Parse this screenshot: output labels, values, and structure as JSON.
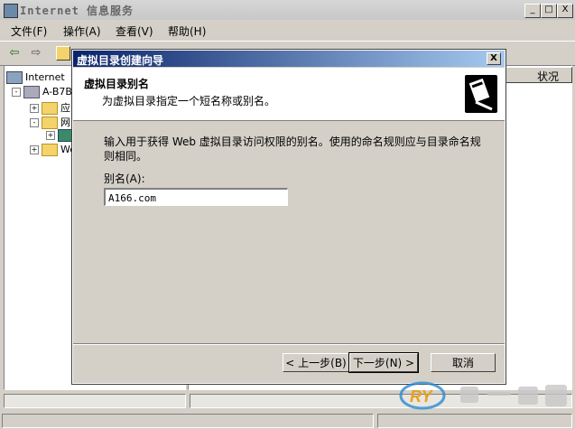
{
  "window": {
    "title": "Internet 信息服务",
    "caption_buttons": [
      "_",
      "□",
      "X"
    ]
  },
  "menu": [
    "文件(F)",
    "操作(A)",
    "查看(V)",
    "帮助(H)"
  ],
  "tree": {
    "root": "Internet",
    "server": "A-B7B",
    "children": [
      "应",
      "网",
      "",
      "We"
    ]
  },
  "list": {
    "column": "状况"
  },
  "dialog": {
    "title": "虚拟目录创建向导",
    "close": "X",
    "header_title": "虚拟目录别名",
    "header_subtitle": "为虚拟目录指定一个短名称或别名。",
    "description": "输入用于获得 Web 虚拟目录访问权限的别名。使用的命名规则应与目录命名规则相同。",
    "alias_label": "别名(A):",
    "alias_value": "A166.com",
    "back_label": "< 上一步(B)",
    "next_label": "下一步(N) >",
    "cancel_label": "取消"
  },
  "watermark": {
    "logo_text": "RY"
  },
  "colors": {
    "title_gradient_start": "#0a246a",
    "title_gradient_end": "#a6caf0",
    "face": "#d4d0c8"
  }
}
